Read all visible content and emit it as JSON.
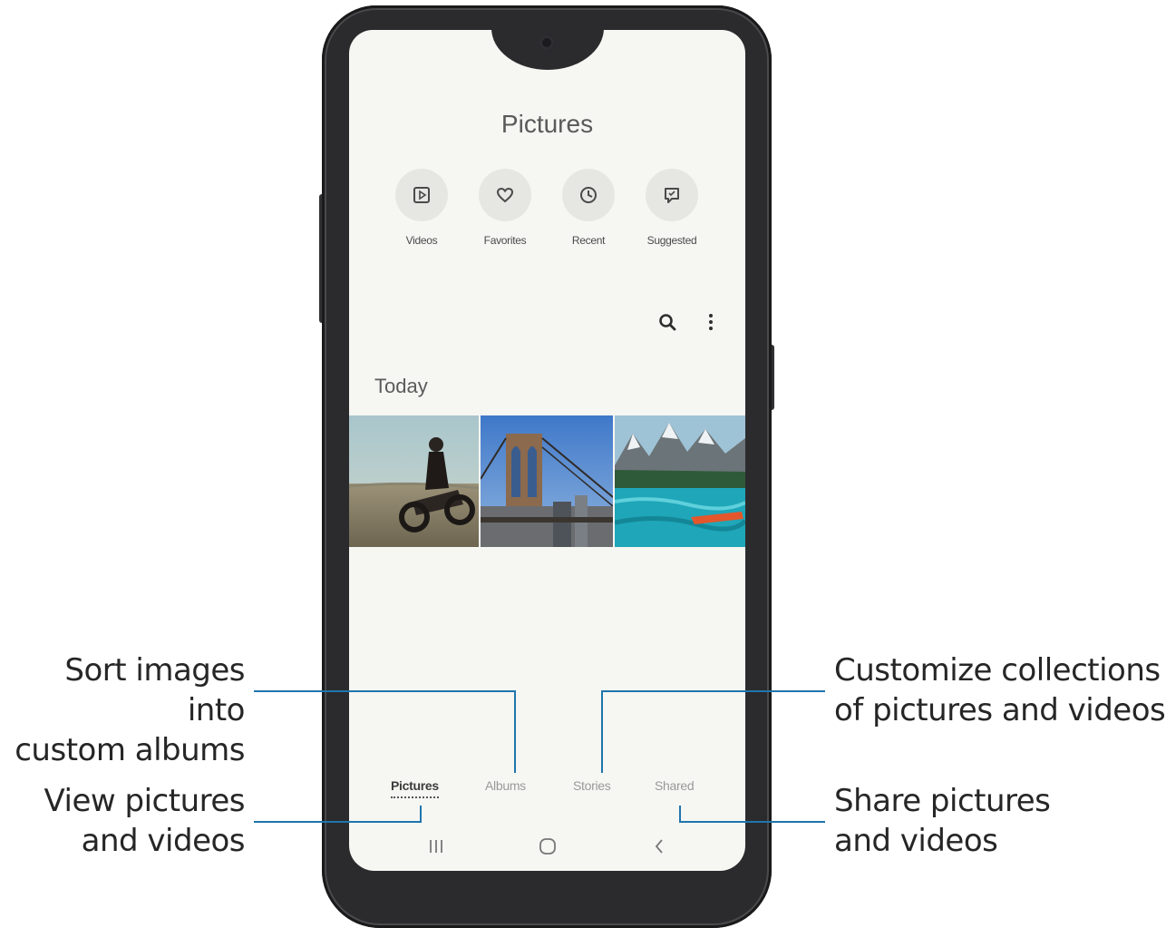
{
  "screen": {
    "title": "Pictures",
    "quick_filters": [
      {
        "label": "Videos",
        "icon": "video-icon"
      },
      {
        "label": "Favorites",
        "icon": "heart-icon"
      },
      {
        "label": "Recent",
        "icon": "clock-icon"
      },
      {
        "label": "Suggested",
        "icon": "suggestion-icon"
      }
    ],
    "toolbar": {
      "search_icon": "search-icon",
      "more_icon": "more-options-icon"
    },
    "section_label": "Today",
    "thumbnails": [
      {
        "subject": "motorcycle rider on beach"
      },
      {
        "subject": "brooklyn bridge"
      },
      {
        "subject": "mountain lake"
      }
    ],
    "tabs": [
      {
        "label": "Pictures",
        "active": true
      },
      {
        "label": "Albums",
        "active": false
      },
      {
        "label": "Stories",
        "active": false
      },
      {
        "label": "Shared",
        "active": false
      }
    ],
    "navigation": {
      "recents": "recent-apps-icon",
      "home": "home-icon",
      "back": "back-icon"
    }
  },
  "callouts": {
    "albums": [
      "Sort images into",
      "custom albums"
    ],
    "pictures": [
      "View pictures",
      "and videos"
    ],
    "stories": [
      "Customize collections",
      "of pictures and videos"
    ],
    "shared": [
      "Share pictures",
      "and videos"
    ]
  },
  "colors": {
    "leader_line": "#1f75ad",
    "screen_bg": "#f6f6f3",
    "phone_body": "#2b2b2d"
  }
}
